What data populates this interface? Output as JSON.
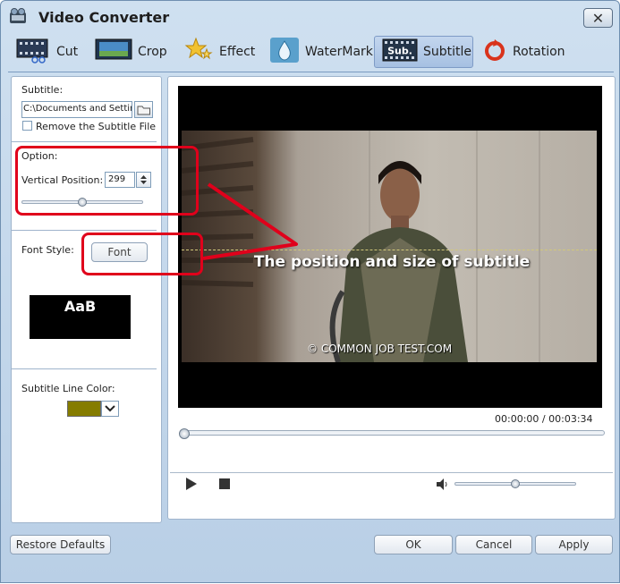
{
  "window": {
    "title": "Video Converter",
    "close_label": "✕"
  },
  "tabs": [
    {
      "label": "Cut"
    },
    {
      "label": "Crop"
    },
    {
      "label": "Effect"
    },
    {
      "label": "WaterMark"
    },
    {
      "label": "Subtitle",
      "icon_text": "Sub."
    },
    {
      "label": "Rotation"
    }
  ],
  "left": {
    "subtitle_label": "Subtitle:",
    "subtitle_path": "C:\\Documents and Settings",
    "remove_label": "Remove the Subtitle File",
    "remove_checked": false,
    "option_label": "Option:",
    "vertical_label": "Vertical Position:",
    "vertical_value": "299",
    "vertical_slider_fraction": 0.5,
    "font_style_label": "Font Style:",
    "font_button": "Font",
    "preview_text": "AaB",
    "line_color_label": "Subtitle Line Color:",
    "line_color": "#857c00"
  },
  "player": {
    "subtitle_overlay": "The position and size of subtitle",
    "watermark": "© COMMON JOB TEST.COM",
    "time_current": "00:00:00",
    "time_sep": "/",
    "time_total": "00:03:34"
  },
  "footer": {
    "restore_label": "Restore Defaults",
    "ok_label": "OK",
    "cancel_label": "Cancel",
    "apply_label": "Apply"
  },
  "colors": {
    "annotation": "#e0001b",
    "accent": "#7e9bc6"
  }
}
